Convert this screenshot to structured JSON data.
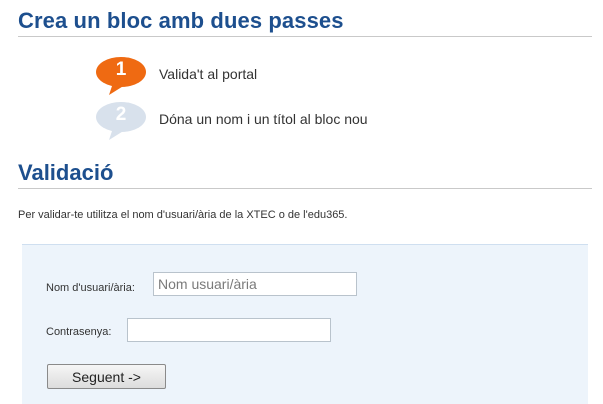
{
  "header": {
    "title": "Crea un bloc amb dues passes"
  },
  "steps": [
    {
      "number": "1",
      "label": "Valida't al portal",
      "color": "#ef6a12",
      "state": "active"
    },
    {
      "number": "2",
      "label": "Dóna un nom i un títol al bloc nou",
      "color": "#d8e1ec",
      "state": "inactive"
    }
  ],
  "validation": {
    "title": "Validació",
    "instructions": "Per validar-te utilitza el nom d'usuari/ària de la XTEC o de l'edu365.",
    "username_label": "Nom d'usuari/ària:",
    "username_value": "",
    "username_placeholder": "Nom usuari/ària",
    "password_label": "Contrasenya:",
    "password_value": "",
    "submit_label": "Seguent ->"
  },
  "colors": {
    "heading": "#1d4f8e",
    "panel_bg": "#edf4fb",
    "active_step": "#ef6a12",
    "inactive_step": "#d8e1ec"
  }
}
